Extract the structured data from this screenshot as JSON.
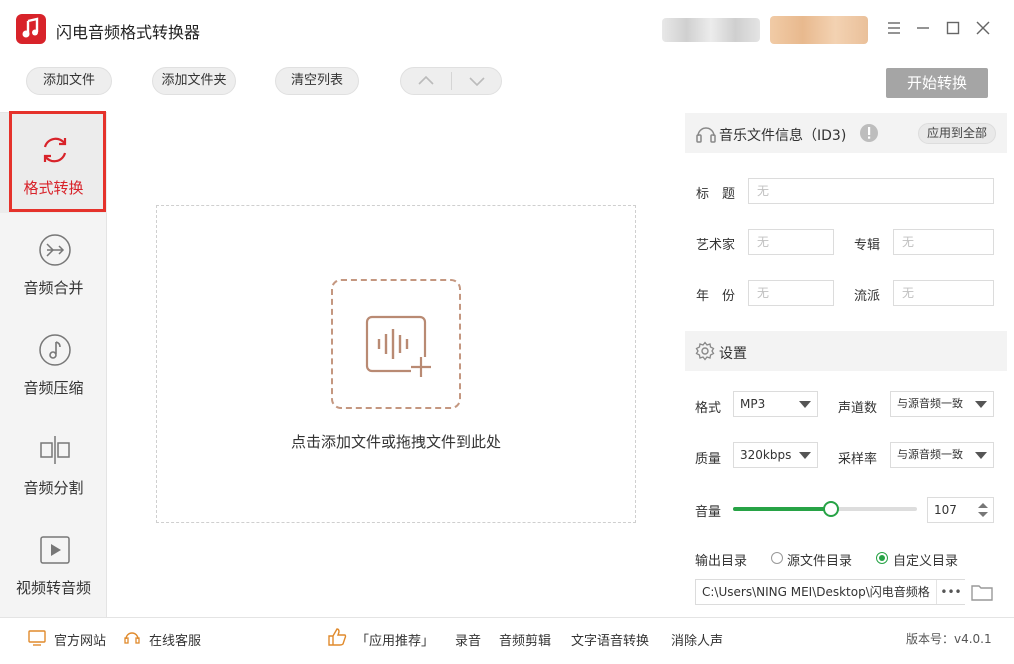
{
  "app": {
    "title": "闪电音频格式转换器"
  },
  "toolbar": {
    "add_file": "添加文件",
    "add_folder": "添加文件夹",
    "clear_list": "清空列表",
    "start": "开始转换"
  },
  "sidebar": {
    "items": [
      {
        "label": "格式转换",
        "icon": "refresh-icon",
        "active": true
      },
      {
        "label": "音频合并",
        "icon": "merge-icon"
      },
      {
        "label": "音频压缩",
        "icon": "music-note-icon"
      },
      {
        "label": "音频分割",
        "icon": "split-icon"
      },
      {
        "label": "视频转音频",
        "icon": "video-play-icon"
      }
    ]
  },
  "main": {
    "drop_text": "点击添加文件或拖拽文件到此处"
  },
  "id3": {
    "title": "音乐文件信息（ID3)",
    "apply_all": "应用到全部",
    "title_label": "标　题",
    "artist_label": "艺术家",
    "album_label": "专辑",
    "year_label": "年　份",
    "genre_label": "流派",
    "placeholder": "无"
  },
  "settings": {
    "title": "设置",
    "format_label": "格式",
    "format_value": "MP3",
    "channels_label": "声道数",
    "channels_value": "与源音频一致",
    "quality_label": "质量",
    "quality_value": "320kbps",
    "samplerate_label": "采样率",
    "samplerate_value": "与源音频一致",
    "volume_label": "音量",
    "volume_value": "107",
    "volume_fraction": 0.53,
    "output_label": "输出目录",
    "output_source": "源文件目录",
    "output_custom": "自定义目录",
    "output_path": "C:\\Users\\NING MEI\\Desktop\\闪电音频格",
    "more": "•••"
  },
  "footer": {
    "website": "官方网站",
    "service": "在线客服",
    "recommend": "「应用推荐」",
    "record": "录音",
    "audio_edit": "音频剪辑",
    "tts": "文字语音转换",
    "vocal_remove": "消除人声",
    "version": "版本号：v4.0.1"
  },
  "colors": {
    "accent": "#d8232a",
    "green": "#27a346",
    "highlight": "#e5322b"
  }
}
